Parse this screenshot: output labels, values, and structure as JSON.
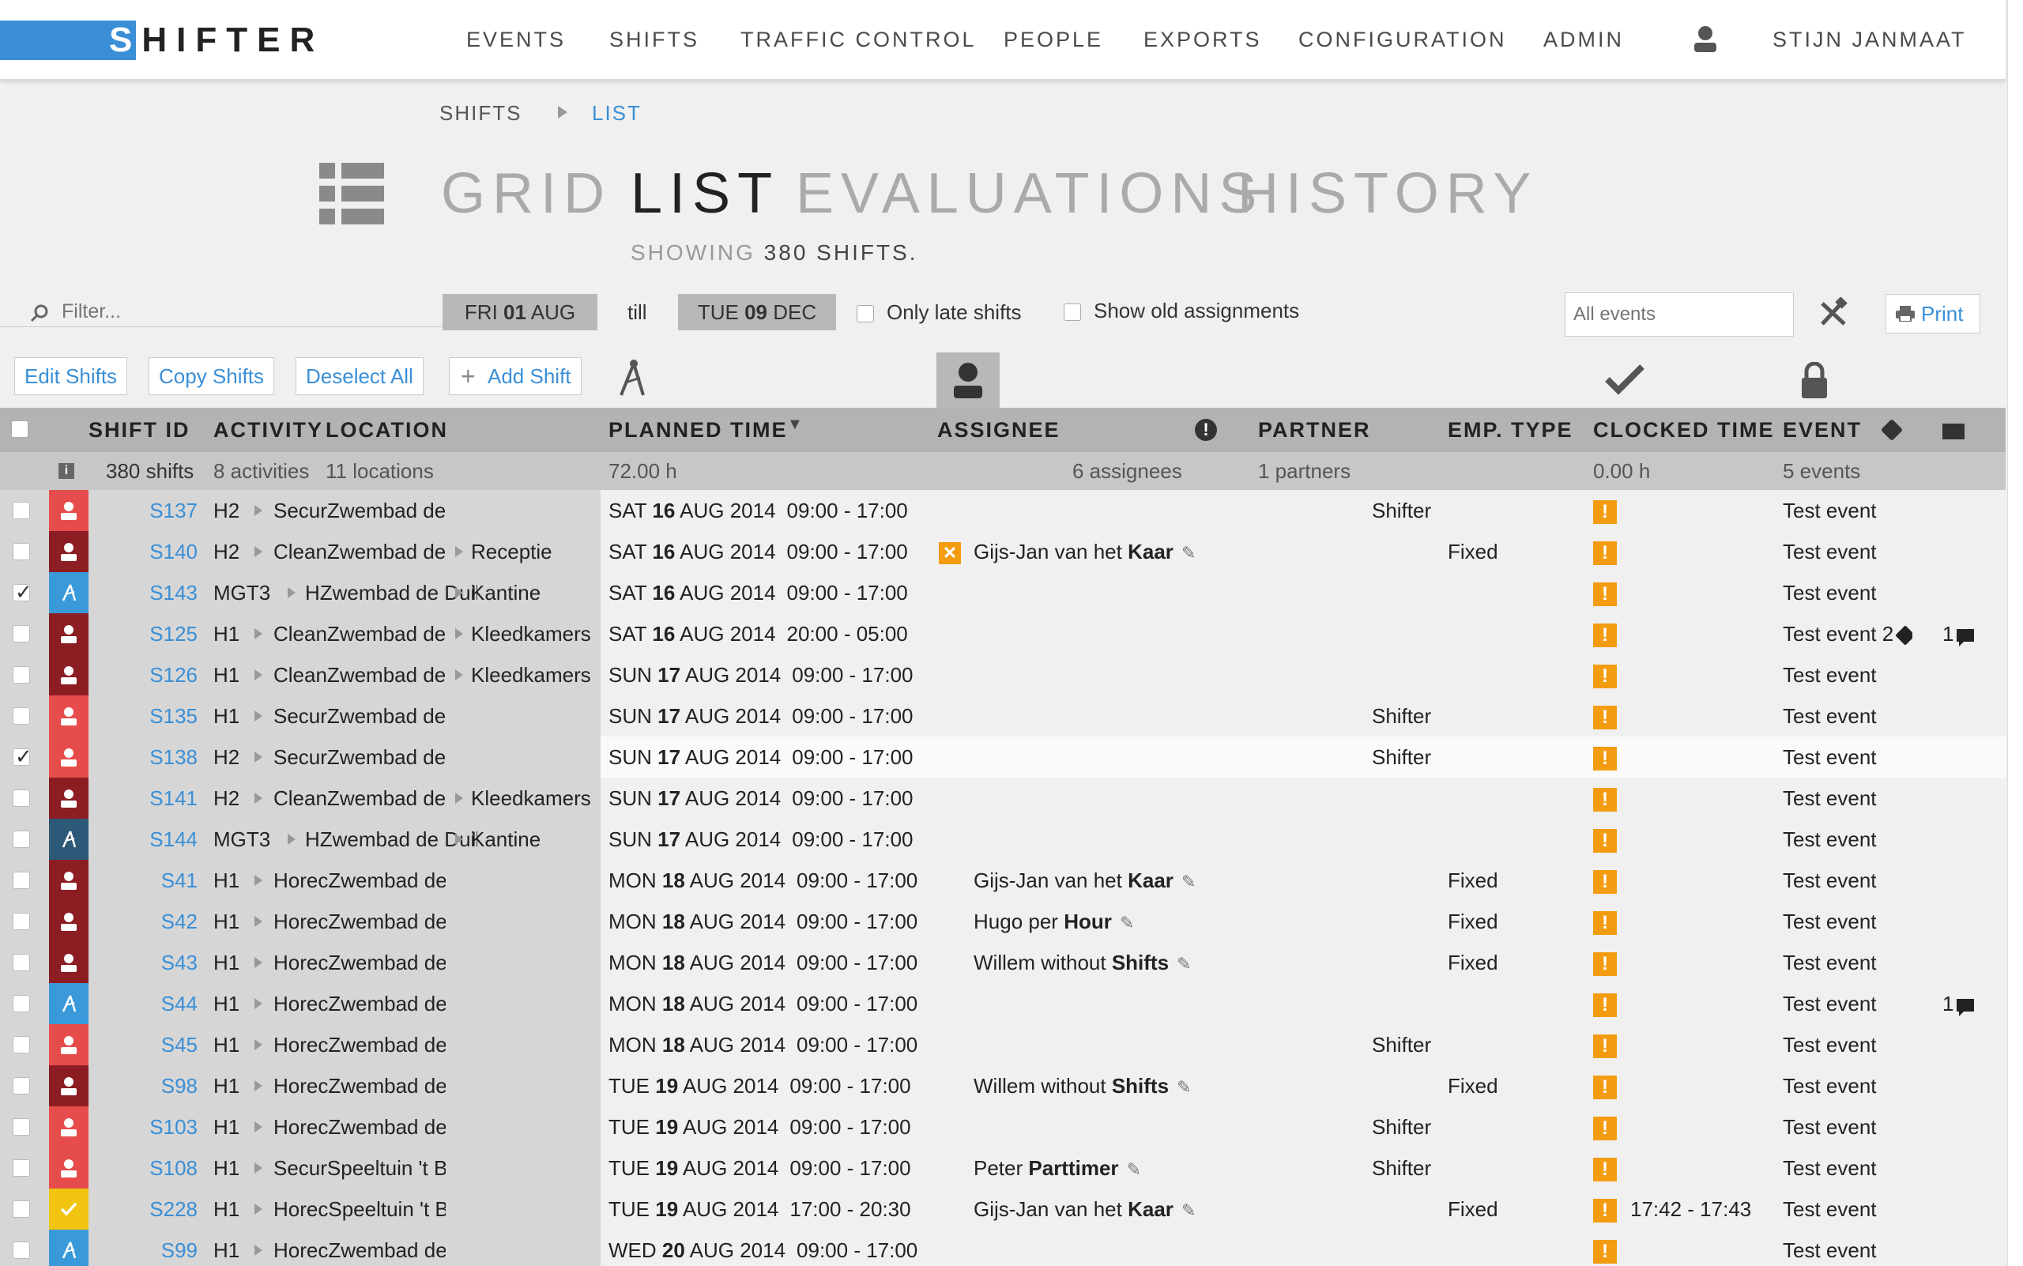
{
  "app": {
    "logo": "SHIFTER",
    "nav": [
      "EVENTS",
      "SHIFTS",
      "TRAFFIC CONTROL",
      "PEOPLE",
      "EXPORTS",
      "CONFIGURATION",
      "ADMIN"
    ],
    "user": "STIJN JANMAAT"
  },
  "breadcrumb": {
    "parent": "SHIFTS",
    "current": "LIST"
  },
  "views": {
    "grid": "GRID",
    "list": "LIST",
    "evaluations": "EVALUATIONS",
    "history": "HISTORY",
    "active": "LIST"
  },
  "showing": {
    "prefix": "SHOWING",
    "count": "380 SHIFTS."
  },
  "filters": {
    "placeholder": "Filter...",
    "from_day": "FRI",
    "from_num": "01",
    "from_month": "AUG",
    "till": "till",
    "to_day": "TUE",
    "to_num": "09",
    "to_month": "DEC",
    "only_late": "Only late shifts",
    "show_old": "Show old assignments",
    "events_placeholder": "All events",
    "print": "Print"
  },
  "actions": {
    "edit": "Edit Shifts",
    "copy": "Copy Shifts",
    "deselect": "Deselect All",
    "add": "Add Shift"
  },
  "columns": {
    "shift_id": "SHIFT ID",
    "activity": "ACTIVITY",
    "location": "LOCATION",
    "planned_time": "PLANNED TIME",
    "assignee": "ASSIGNEE",
    "partner": "PARTNER",
    "emp_type": "EMP. TYPE",
    "clocked_time": "CLOCKED TIME",
    "event": "EVENT"
  },
  "summary": {
    "shifts": "380 shifts",
    "activities": "8 activities",
    "locations": "11 locations",
    "hours": "72.00 h",
    "assignees": "6 assignees",
    "partners": "1 partners",
    "clocked": "0.00 h",
    "events": "5 events"
  },
  "colors": {
    "red": "#e74c4c",
    "darkred": "#8b1d23",
    "blue": "#3a9ad9",
    "navy": "#2e5877",
    "yellow": "#f1c40f",
    "orange": "#f39c12",
    "link": "#3a8fd6"
  },
  "rows": [
    {
      "id": "S137",
      "act": "H2",
      "loc": "SecurZwembad de Duikelaar",
      "sub": "",
      "dow": "SAT",
      "d": "16",
      "rest": "AUG 2014",
      "time": "09:00 - 17:00",
      "assignee_first": "",
      "assignee_last": "",
      "partner": "Shifter",
      "emp": "",
      "clocked": "",
      "event": "Test event",
      "tags": "",
      "comments": "",
      "status": "red",
      "checked": false,
      "hl": false,
      "x": false
    },
    {
      "id": "S140",
      "act": "H2",
      "loc": "CleanZwembad de Duil",
      "sub": "Receptie",
      "dow": "SAT",
      "d": "16",
      "rest": "AUG 2014",
      "time": "09:00 - 17:00",
      "assignee_first": "Gijs-Jan van het",
      "assignee_last": "Kaar",
      "partner": "",
      "emp": "Fixed",
      "clocked": "",
      "event": "Test event",
      "tags": "",
      "comments": "",
      "status": "darkred",
      "checked": false,
      "hl": false,
      "x": true
    },
    {
      "id": "S143",
      "act": "MGT3",
      "loc": "HZwembad de Duik",
      "sub": "Kantine",
      "dow": "SAT",
      "d": "16",
      "rest": "AUG 2014",
      "time": "09:00 - 17:00",
      "assignee_first": "",
      "assignee_last": "",
      "partner": "",
      "emp": "",
      "clocked": "",
      "event": "Test event",
      "tags": "",
      "comments": "",
      "status": "blue",
      "checked": true,
      "hl": false,
      "x": false
    },
    {
      "id": "S125",
      "act": "H1",
      "loc": "CleanZwembad de",
      "sub": "Kleedkamers",
      "dow": "SAT",
      "d": "16",
      "rest": "AUG 2014",
      "time": "20:00 - 05:00",
      "assignee_first": "",
      "assignee_last": "",
      "partner": "",
      "emp": "",
      "clocked": "",
      "event": "Test event 2",
      "tags": "tag",
      "comments": "1",
      "status": "darkred",
      "checked": false,
      "hl": false,
      "x": false
    },
    {
      "id": "S126",
      "act": "H1",
      "loc": "CleanZwembad de",
      "sub": "Kleedkamers",
      "dow": "SUN",
      "d": "17",
      "rest": "AUG 2014",
      "time": "09:00 - 17:00",
      "assignee_first": "",
      "assignee_last": "",
      "partner": "",
      "emp": "",
      "clocked": "",
      "event": "Test event",
      "tags": "",
      "comments": "",
      "status": "darkred",
      "checked": false,
      "hl": false,
      "x": false
    },
    {
      "id": "S135",
      "act": "H1",
      "loc": "SecurZwembad de Duikelaar",
      "sub": "",
      "dow": "SUN",
      "d": "17",
      "rest": "AUG 2014",
      "time": "09:00 - 17:00",
      "assignee_first": "",
      "assignee_last": "",
      "partner": "Shifter",
      "emp": "",
      "clocked": "",
      "event": "Test event",
      "tags": "",
      "comments": "",
      "status": "red",
      "checked": false,
      "hl": false,
      "x": false
    },
    {
      "id": "S138",
      "act": "H2",
      "loc": "SecurZwembad de Duikelaar",
      "sub": "",
      "dow": "SUN",
      "d": "17",
      "rest": "AUG 2014",
      "time": "09:00 - 17:00",
      "assignee_first": "",
      "assignee_last": "",
      "partner": "Shifter",
      "emp": "",
      "clocked": "",
      "event": "Test event",
      "tags": "",
      "comments": "",
      "status": "red",
      "checked": true,
      "hl": true,
      "x": false
    },
    {
      "id": "S141",
      "act": "H2",
      "loc": "CleanZwembad de",
      "sub": "Kleedkamers",
      "dow": "SUN",
      "d": "17",
      "rest": "AUG 2014",
      "time": "09:00 - 17:00",
      "assignee_first": "",
      "assignee_last": "",
      "partner": "",
      "emp": "",
      "clocked": "",
      "event": "Test event",
      "tags": "",
      "comments": "",
      "status": "darkred",
      "checked": false,
      "hl": false,
      "x": false
    },
    {
      "id": "S144",
      "act": "MGT3",
      "loc": "HZwembad de Duik",
      "sub": "Kantine",
      "dow": "SUN",
      "d": "17",
      "rest": "AUG 2014",
      "time": "09:00 - 17:00",
      "assignee_first": "",
      "assignee_last": "",
      "partner": "",
      "emp": "",
      "clocked": "",
      "event": "Test event",
      "tags": "",
      "comments": "",
      "status": "navy",
      "checked": false,
      "hl": false,
      "x": false
    },
    {
      "id": "S41",
      "act": "H1",
      "loc": "HorecZwembad de Duikelaar",
      "sub": "",
      "dow": "MON",
      "d": "18",
      "rest": "AUG 2014",
      "time": "09:00 - 17:00",
      "assignee_first": "Gijs-Jan van het",
      "assignee_last": "Kaar",
      "partner": "",
      "emp": "Fixed",
      "clocked": "",
      "event": "Test event",
      "tags": "",
      "comments": "",
      "status": "darkred",
      "checked": false,
      "hl": false,
      "x": false
    },
    {
      "id": "S42",
      "act": "H1",
      "loc": "HorecZwembad de Duikelaar",
      "sub": "",
      "dow": "MON",
      "d": "18",
      "rest": "AUG 2014",
      "time": "09:00 - 17:00",
      "assignee_first": "Hugo per",
      "assignee_last": "Hour",
      "partner": "",
      "emp": "Fixed",
      "clocked": "",
      "event": "Test event",
      "tags": "",
      "comments": "",
      "status": "darkred",
      "checked": false,
      "hl": false,
      "x": false
    },
    {
      "id": "S43",
      "act": "H1",
      "loc": "HorecZwembad de Duikelaar",
      "sub": "",
      "dow": "MON",
      "d": "18",
      "rest": "AUG 2014",
      "time": "09:00 - 17:00",
      "assignee_first": "Willem without",
      "assignee_last": "Shifts",
      "partner": "",
      "emp": "Fixed",
      "clocked": "",
      "event": "Test event",
      "tags": "",
      "comments": "",
      "status": "darkred",
      "checked": false,
      "hl": false,
      "x": false
    },
    {
      "id": "S44",
      "act": "H1",
      "loc": "HorecZwembad de Duikelaar",
      "sub": "",
      "dow": "MON",
      "d": "18",
      "rest": "AUG 2014",
      "time": "09:00 - 17:00",
      "assignee_first": "",
      "assignee_last": "",
      "partner": "",
      "emp": "",
      "clocked": "",
      "event": "Test event",
      "tags": "",
      "comments": "1",
      "status": "blue",
      "checked": false,
      "hl": false,
      "x": false
    },
    {
      "id": "S45",
      "act": "H1",
      "loc": "HorecZwembad de Duikelaar",
      "sub": "",
      "dow": "MON",
      "d": "18",
      "rest": "AUG 2014",
      "time": "09:00 - 17:00",
      "assignee_first": "",
      "assignee_last": "",
      "partner": "Shifter",
      "emp": "",
      "clocked": "",
      "event": "Test event",
      "tags": "",
      "comments": "",
      "status": "red",
      "checked": false,
      "hl": false,
      "x": false
    },
    {
      "id": "S98",
      "act": "H1",
      "loc": "HorecZwembad de Duikelaar",
      "sub": "",
      "dow": "TUE",
      "d": "19",
      "rest": "AUG 2014",
      "time": "09:00 - 17:00",
      "assignee_first": "Willem without",
      "assignee_last": "Shifts",
      "partner": "",
      "emp": "Fixed",
      "clocked": "",
      "event": "Test event",
      "tags": "",
      "comments": "",
      "status": "darkred",
      "checked": false,
      "hl": false,
      "x": false
    },
    {
      "id": "S103",
      "act": "H1",
      "loc": "HorecZwembad de Duikelaar",
      "sub": "",
      "dow": "TUE",
      "d": "19",
      "rest": "AUG 2014",
      "time": "09:00 - 17:00",
      "assignee_first": "",
      "assignee_last": "",
      "partner": "Shifter",
      "emp": "",
      "clocked": "",
      "event": "Test event",
      "tags": "",
      "comments": "",
      "status": "red",
      "checked": false,
      "hl": false,
      "x": false
    },
    {
      "id": "S108",
      "act": "H1",
      "loc": "SecurSpeeltuin 't Bos",
      "sub": "",
      "dow": "TUE",
      "d": "19",
      "rest": "AUG 2014",
      "time": "09:00 - 17:00",
      "assignee_first": "Peter",
      "assignee_last": "Parttimer",
      "partner": "Shifter",
      "emp": "",
      "clocked": "",
      "event": "Test event",
      "tags": "",
      "comments": "",
      "status": "red",
      "checked": false,
      "hl": false,
      "x": false
    },
    {
      "id": "S228",
      "act": "H1",
      "loc": "HorecSpeeltuin 't Bos",
      "sub": "",
      "dow": "TUE",
      "d": "19",
      "rest": "AUG 2014",
      "time": "17:00 - 20:30",
      "assignee_first": "Gijs-Jan van het",
      "assignee_last": "Kaar",
      "partner": "",
      "emp": "Fixed",
      "clocked": "17:42 - 17:43",
      "event": "Test event",
      "tags": "",
      "comments": "",
      "status": "yellow",
      "checked": false,
      "hl": false,
      "x": false
    },
    {
      "id": "S99",
      "act": "H1",
      "loc": "HorecZwembad de Duikelaar",
      "sub": "",
      "dow": "WED",
      "d": "20",
      "rest": "AUG 2014",
      "time": "09:00 - 17:00",
      "assignee_first": "",
      "assignee_last": "",
      "partner": "",
      "emp": "",
      "clocked": "",
      "event": "Test event",
      "tags": "",
      "comments": "",
      "status": "blue",
      "checked": false,
      "hl": false,
      "x": false
    }
  ]
}
